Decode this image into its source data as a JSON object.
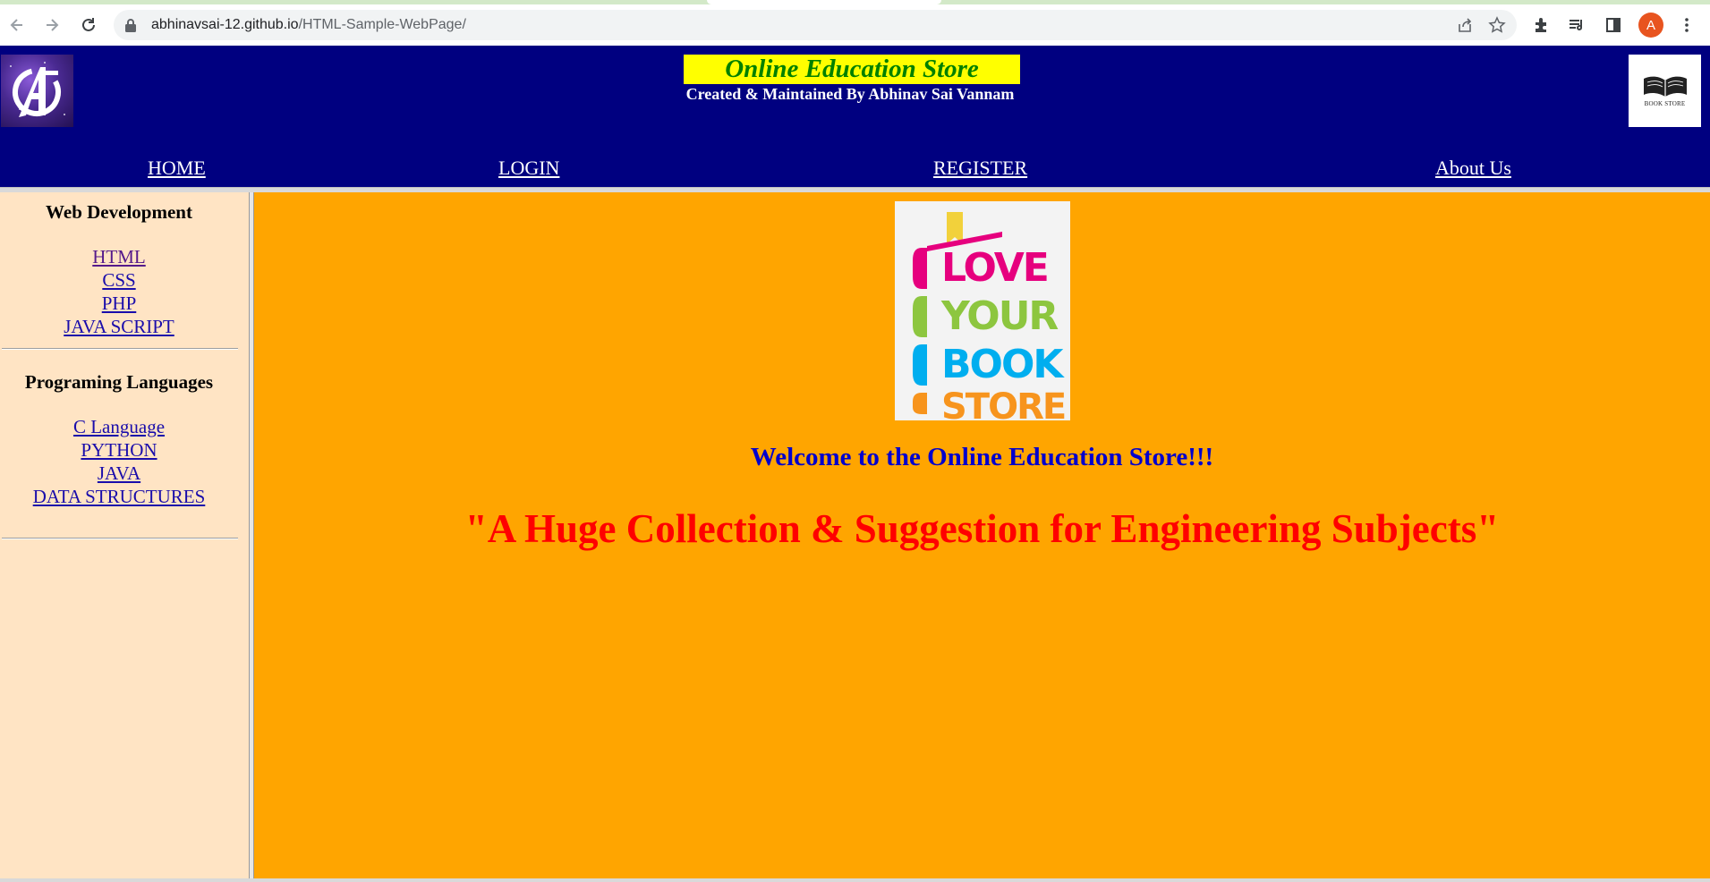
{
  "browser": {
    "url_host": "abhinavsai-12.github.io",
    "url_path": "/HTML-Sample-WebPage/",
    "profile_initial": "A",
    "icons": [
      "back-icon",
      "forward-icon",
      "reload-icon",
      "lock-icon",
      "share-icon",
      "star-icon",
      "extensions-icon",
      "reading-list-icon",
      "side-panel-icon",
      "menu-icon"
    ]
  },
  "header": {
    "title": "Online Education Store",
    "subtitle": "Created & Maintained By Abhinav Sai Vannam",
    "right_logo_caption": "BOOK STORE",
    "nav": [
      "HOME",
      "LOGIN",
      "REGISTER",
      "About Us"
    ]
  },
  "sidebar": {
    "sections": [
      {
        "heading": "Web Development",
        "links": [
          "HTML",
          "CSS",
          "PHP",
          "JAVA SCRIPT"
        ]
      },
      {
        "heading": "Programing Languages",
        "links": [
          "C Language",
          "PYTHON",
          "JAVA",
          "DATA STRUCTURES"
        ]
      }
    ]
  },
  "main": {
    "logo_words": [
      "LOVE",
      "YOUR",
      "BOOK",
      "STORE"
    ],
    "welcome": "Welcome to the Online Education Store!!!",
    "tagline": "\"A Huge Collection & Suggestion for Engineering Subjects\""
  },
  "colors": {
    "header_bg": "#000080",
    "title_bg": "#ffff00",
    "title_text": "#008000",
    "sidebar_bg": "#ffe4c4",
    "main_bg": "#ffa500",
    "welcome_text": "#0000cd",
    "tagline_text": "#ff0000",
    "logo_pink": "#e6007e",
    "logo_green": "#8dc63f",
    "logo_blue": "#00aeef",
    "logo_orange": "#f7941d"
  }
}
